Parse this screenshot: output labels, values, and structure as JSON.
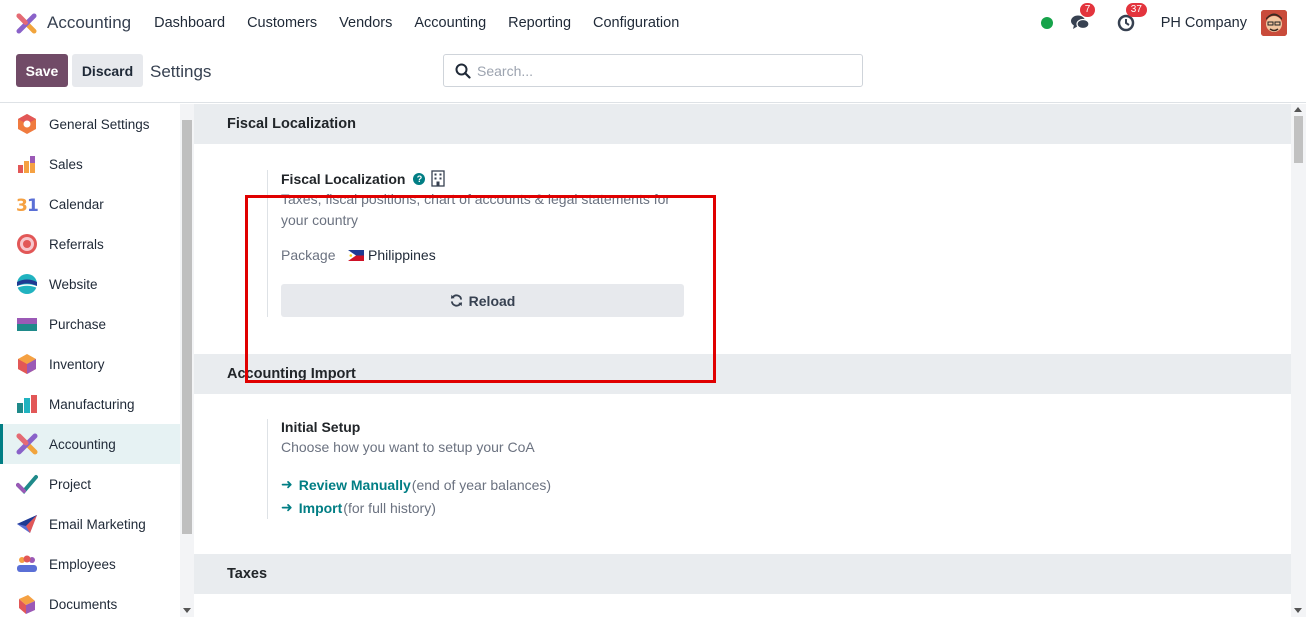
{
  "navbar": {
    "app_name": "Accounting",
    "menu": [
      "Dashboard",
      "Customers",
      "Vendors",
      "Accounting",
      "Reporting",
      "Configuration"
    ],
    "messages_count": "7",
    "activities_count": "37",
    "company": "PH Company"
  },
  "control": {
    "save_label": "Save",
    "discard_label": "Discard",
    "title": "Settings",
    "search_placeholder": "Search..."
  },
  "sidebar": {
    "items": [
      {
        "label": "General Settings",
        "icon": "general-settings-icon"
      },
      {
        "label": "Sales",
        "icon": "sales-icon"
      },
      {
        "label": "Calendar",
        "icon": "calendar-icon"
      },
      {
        "label": "Referrals",
        "icon": "referrals-icon"
      },
      {
        "label": "Website",
        "icon": "website-icon"
      },
      {
        "label": "Purchase",
        "icon": "purchase-icon"
      },
      {
        "label": "Inventory",
        "icon": "inventory-icon"
      },
      {
        "label": "Manufacturing",
        "icon": "manufacturing-icon"
      },
      {
        "label": "Accounting",
        "icon": "accounting-icon",
        "active": true
      },
      {
        "label": "Project",
        "icon": "project-icon"
      },
      {
        "label": "Email Marketing",
        "icon": "email-marketing-icon"
      },
      {
        "label": "Employees",
        "icon": "employees-icon"
      },
      {
        "label": "Documents",
        "icon": "documents-icon"
      }
    ]
  },
  "fiscal": {
    "section_title": "Fiscal Localization",
    "setting_title": "Fiscal Localization",
    "help": "?",
    "description": "Taxes, fiscal positions, chart of accounts & legal statements for your country",
    "package_label": "Package",
    "package_value": "Philippines",
    "reload_label": "Reload"
  },
  "import": {
    "section_title": "Accounting Import",
    "setting_title": "Initial Setup",
    "description": "Choose how you want to setup your CoA",
    "arrow": "➜",
    "links": [
      {
        "label": "Review Manually",
        "note": "(end of year balances)"
      },
      {
        "label": "Import",
        "note": "(for full history)"
      }
    ]
  },
  "taxes": {
    "section_title": "Taxes"
  },
  "colors": {
    "brand": "#714b67",
    "accent": "#017e84",
    "highlight": "#e00000",
    "online": "#16a34a",
    "badge": "#e3343d"
  }
}
